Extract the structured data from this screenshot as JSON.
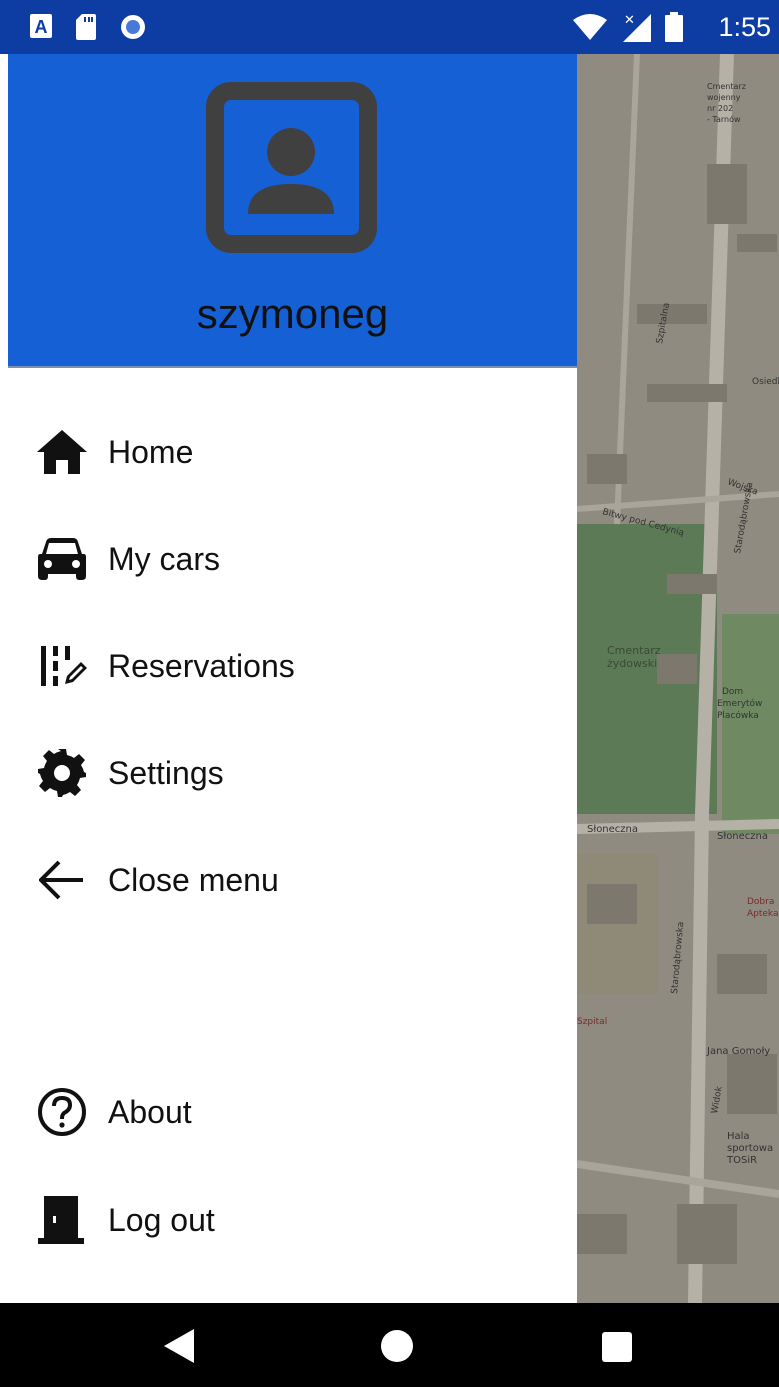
{
  "status_bar": {
    "time": "1:55",
    "left_icons": [
      "accessibility-a-icon",
      "sd-card-icon",
      "record-icon"
    ],
    "right_icons": [
      "wifi-icon",
      "no-signal-icon",
      "battery-icon"
    ]
  },
  "drawer": {
    "username": "szymoneg",
    "items": [
      {
        "label": "Home",
        "icon": "home-icon"
      },
      {
        "label": "My cars",
        "icon": "car-icon"
      },
      {
        "label": "Reservations",
        "icon": "reservations-icon"
      },
      {
        "label": "Settings",
        "icon": "gear-icon"
      },
      {
        "label": "Close menu",
        "icon": "arrow-left-icon"
      }
    ],
    "footer_items": [
      {
        "label": "About",
        "icon": "help-circle-icon"
      },
      {
        "label": "Log out",
        "icon": "door-exit-icon"
      }
    ]
  },
  "map": {
    "labels": [
      "Cmentarz żydowski",
      "Słoneczna",
      "Starodąbrowska",
      "Bitwy pod Cedynią",
      "Szpitalna",
      "Jana Gomoły",
      "Widok",
      "Hala sportowa TOSiR",
      "Dobra Apteka",
      "Dom Emerytów Placówka Pielęgnacyjno-Opiekuńcza Caritas",
      "Osiedle Po",
      "Wojska",
      "Szpital",
      "Cmentarz wojenny nr 202 - Tarnów"
    ]
  },
  "nav_bar": {
    "buttons": [
      "back-icon",
      "home-circle-icon",
      "recents-icon"
    ]
  }
}
